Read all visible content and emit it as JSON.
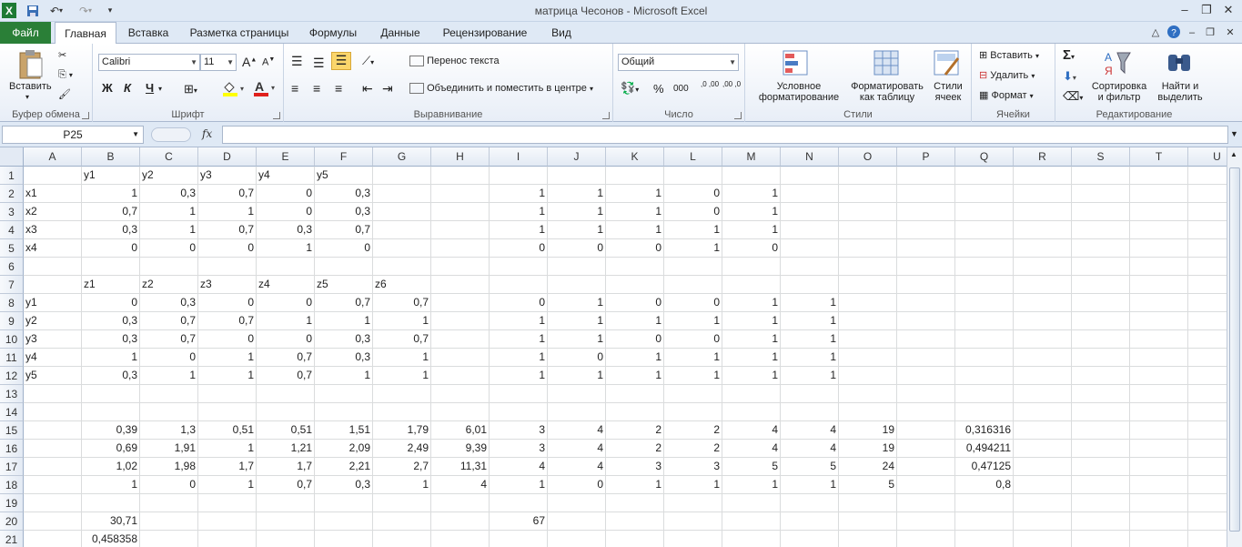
{
  "window": {
    "title": "матрица Чесонов  -  Microsoft Excel"
  },
  "quick_access": {
    "save_icon": "save-icon",
    "undo_icon": "undo-icon",
    "redo_icon": "redo-icon"
  },
  "tabs": [
    {
      "label": "Файл"
    },
    {
      "label": "Главная"
    },
    {
      "label": "Вставка"
    },
    {
      "label": "Разметка страницы"
    },
    {
      "label": "Формулы"
    },
    {
      "label": "Данные"
    },
    {
      "label": "Рецензирование"
    },
    {
      "label": "Вид"
    }
  ],
  "ribbon": {
    "clipboard": {
      "label": "Буфер обмена",
      "paste": "Вставить"
    },
    "font": {
      "label": "Шрифт",
      "name": "Calibri",
      "size": "11",
      "bold": "Ж",
      "italic": "К",
      "underline": "Ч",
      "grow": "A",
      "shrink": "A"
    },
    "alignment": {
      "label": "Выравнивание",
      "wrap": "Перенос текста",
      "merge": "Объединить и поместить в центре"
    },
    "number": {
      "label": "Число",
      "format": "Общий",
      "percent": "%",
      "thousands": "000",
      "inc_decimal": ",0 ,00",
      "dec_decimal": ",00 ,0"
    },
    "styles": {
      "label": "Стили",
      "cond": "Условное форматирование",
      "table": "Форматировать как таблицу",
      "cell": "Стили ячеек"
    },
    "cells": {
      "label": "Ячейки",
      "insert": "Вставить",
      "delete": "Удалить",
      "format": "Формат"
    },
    "editing": {
      "label": "Редактирование",
      "sort": "Сортировка и фильтр",
      "find": "Найти и выделить",
      "sum": "Σ"
    }
  },
  "formula_bar": {
    "name_box": "P25",
    "fx": "fx",
    "value": ""
  },
  "columns": [
    "A",
    "B",
    "C",
    "D",
    "E",
    "F",
    "G",
    "H",
    "I",
    "J",
    "K",
    "L",
    "M",
    "N",
    "O",
    "P",
    "Q",
    "R",
    "S",
    "T",
    "U"
  ],
  "rows": [
    "1",
    "2",
    "3",
    "4",
    "5",
    "6",
    "7",
    "8",
    "9",
    "10",
    "11",
    "12",
    "13",
    "14",
    "15",
    "16",
    "17",
    "18",
    "19",
    "20",
    "21"
  ],
  "cells": {
    "1": {
      "B": "y1",
      "C": "y2",
      "D": "y3",
      "E": "y4",
      "F": "y5"
    },
    "2": {
      "A": "x1",
      "B": "1",
      "C": "0,3",
      "D": "0,7",
      "E": "0",
      "F": "0,3",
      "I": "1",
      "J": "1",
      "K": "1",
      "L": "0",
      "M": "1"
    },
    "3": {
      "A": "x2",
      "B": "0,7",
      "C": "1",
      "D": "1",
      "E": "0",
      "F": "0,3",
      "I": "1",
      "J": "1",
      "K": "1",
      "L": "0",
      "M": "1"
    },
    "4": {
      "A": "x3",
      "B": "0,3",
      "C": "1",
      "D": "0,7",
      "E": "0,3",
      "F": "0,7",
      "I": "1",
      "J": "1",
      "K": "1",
      "L": "1",
      "M": "1"
    },
    "5": {
      "A": "x4",
      "B": "0",
      "C": "0",
      "D": "0",
      "E": "1",
      "F": "0",
      "I": "0",
      "J": "0",
      "K": "0",
      "L": "1",
      "M": "0"
    },
    "7": {
      "B": "z1",
      "C": "z2",
      "D": "z3",
      "E": "z4",
      "F": "z5",
      "G": "z6"
    },
    "8": {
      "A": "y1",
      "B": "0",
      "C": "0,3",
      "D": "0",
      "E": "0",
      "F": "0,7",
      "G": "0,7",
      "I": "0",
      "J": "1",
      "K": "0",
      "L": "0",
      "M": "1",
      "N": "1"
    },
    "9": {
      "A": "y2",
      "B": "0,3",
      "C": "0,7",
      "D": "0,7",
      "E": "1",
      "F": "1",
      "G": "1",
      "I": "1",
      "J": "1",
      "K": "1",
      "L": "1",
      "M": "1",
      "N": "1"
    },
    "10": {
      "A": "y3",
      "B": "0,3",
      "C": "0,7",
      "D": "0",
      "E": "0",
      "F": "0,3",
      "G": "0,7",
      "I": "1",
      "J": "1",
      "K": "0",
      "L": "0",
      "M": "1",
      "N": "1"
    },
    "11": {
      "A": "y4",
      "B": "1",
      "C": "0",
      "D": "1",
      "E": "0,7",
      "F": "0,3",
      "G": "1",
      "I": "1",
      "J": "0",
      "K": "1",
      "L": "1",
      "M": "1",
      "N": "1"
    },
    "12": {
      "A": "y5",
      "B": "0,3",
      "C": "1",
      "D": "1",
      "E": "0,7",
      "F": "1",
      "G": "1",
      "I": "1",
      "J": "1",
      "K": "1",
      "L": "1",
      "M": "1",
      "N": "1"
    },
    "15": {
      "B": "0,39",
      "C": "1,3",
      "D": "0,51",
      "E": "0,51",
      "F": "1,51",
      "G": "1,79",
      "H": "6,01",
      "I": "3",
      "J": "4",
      "K": "2",
      "L": "2",
      "M": "4",
      "N": "4",
      "O": "19",
      "Q": "0,316316"
    },
    "16": {
      "B": "0,69",
      "C": "1,91",
      "D": "1",
      "E": "1,21",
      "F": "2,09",
      "G": "2,49",
      "H": "9,39",
      "I": "3",
      "J": "4",
      "K": "2",
      "L": "2",
      "M": "4",
      "N": "4",
      "O": "19",
      "Q": "0,494211"
    },
    "17": {
      "B": "1,02",
      "C": "1,98",
      "D": "1,7",
      "E": "1,7",
      "F": "2,21",
      "G": "2,7",
      "H": "11,31",
      "I": "4",
      "J": "4",
      "K": "3",
      "L": "3",
      "M": "5",
      "N": "5",
      "O": "24",
      "Q": "0,47125"
    },
    "18": {
      "B": "1",
      "C": "0",
      "D": "1",
      "E": "0,7",
      "F": "0,3",
      "G": "1",
      "H": "4",
      "I": "1",
      "J": "0",
      "K": "1",
      "L": "1",
      "M": "1",
      "N": "1",
      "O": "5",
      "Q": "0,8"
    },
    "20": {
      "B": "30,71",
      "I": "67"
    },
    "21": {
      "B": "0,458358"
    }
  }
}
